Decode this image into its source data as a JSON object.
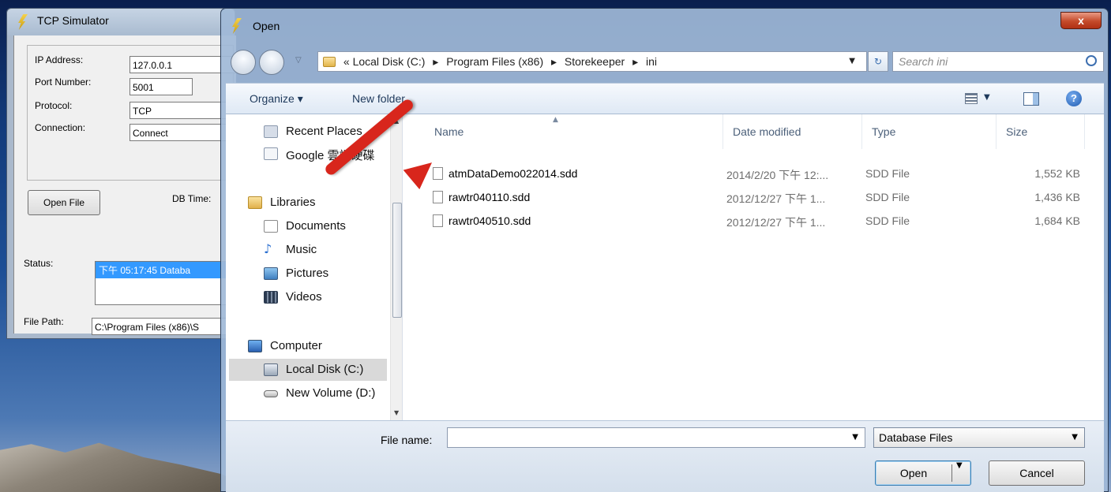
{
  "tcp_window": {
    "title": "TCP Simulator",
    "ip_label": "IP Address:",
    "ip_value": "127.0.0.1",
    "port_label": "Port Number:",
    "port_value": "5001",
    "protocol_label": "Protocol:",
    "protocol_value": "TCP",
    "connection_label": "Connection:",
    "connection_value": "Connect",
    "open_file_button": "Open File",
    "db_time_label": "DB Time:",
    "status_label": "Status:",
    "status_line": "下午 05:17:45  Databa",
    "file_path_label": "File Path:",
    "file_path_value": "C:\\Program Files (x86)\\S"
  },
  "dialog": {
    "title": "Open",
    "close_label": "x",
    "address": {
      "prefix": "«",
      "path": [
        "Local Disk (C:)",
        "Program Files (x86)",
        "Storekeeper",
        "ini"
      ],
      "separator": "▸"
    },
    "search_placeholder": "Search ini",
    "toolbar": {
      "organize": "Organize ▾",
      "new_folder": "New folder"
    },
    "nav_items": [
      {
        "label": "Recent Places",
        "icon": "recent-places-icon"
      },
      {
        "label": "Google 雲端硬碟",
        "icon": "google-drive-icon"
      },
      {
        "label": "Libraries",
        "icon": "libraries-icon"
      },
      {
        "label": "Documents",
        "icon": "documents-icon"
      },
      {
        "label": "Music",
        "icon": "music-icon"
      },
      {
        "label": "Pictures",
        "icon": "pictures-icon"
      },
      {
        "label": "Videos",
        "icon": "videos-icon"
      },
      {
        "label": "Computer",
        "icon": "computer-icon"
      },
      {
        "label": "Local Disk (C:)",
        "icon": "local-disk-icon"
      },
      {
        "label": "New Volume (D:)",
        "icon": "drive-icon"
      }
    ],
    "columns": [
      "Name",
      "Date modified",
      "Type",
      "Size"
    ],
    "files": [
      {
        "name": "atmDataDemo022014.sdd",
        "date": "2014/2/20 下午 12:...",
        "type": "SDD File",
        "size": "1,552 KB"
      },
      {
        "name": "rawtr040110.sdd",
        "date": "2012/12/27 下午 1...",
        "type": "SDD File",
        "size": "1,436 KB"
      },
      {
        "name": "rawtr040510.sdd",
        "date": "2012/12/27 下午 1...",
        "type": "SDD File",
        "size": "1,684 KB"
      }
    ],
    "file_name_label": "File name:",
    "file_name_value": "",
    "filter_value": "Database Files",
    "open_button": "Open",
    "cancel_button": "Cancel"
  },
  "colors": {
    "accent_red_arrow": "#d8261c",
    "selection_blue": "#3399ff"
  }
}
